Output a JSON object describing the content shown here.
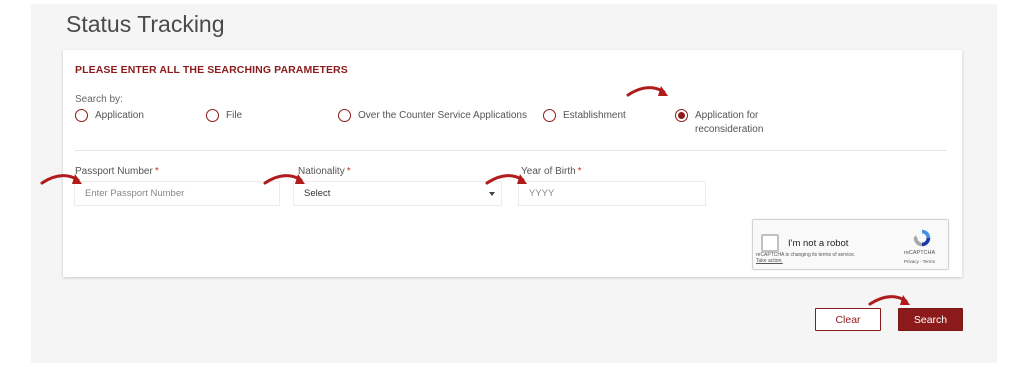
{
  "page": {
    "title": "Status Tracking"
  },
  "form": {
    "section_title": "PLEASE ENTER ALL THE SEARCHING PARAMETERS",
    "search_by_label": "Search by:",
    "search_by_options": [
      {
        "label": "Application",
        "selected": false
      },
      {
        "label": "File",
        "selected": false
      },
      {
        "label": "Over the Counter Service Applications",
        "selected": false
      },
      {
        "label": "Establishment",
        "selected": false
      },
      {
        "label": "Application for reconsideration",
        "selected": true
      }
    ],
    "fields": {
      "passport": {
        "label": "Passport Number",
        "required_mark": "*",
        "placeholder": "Enter Passport Number",
        "value": ""
      },
      "nationality": {
        "label": "Nationality",
        "required_mark": "*",
        "selected": "Select"
      },
      "year_of_birth": {
        "label": "Year of Birth",
        "required_mark": "*",
        "placeholder": "YYYY",
        "value": ""
      }
    }
  },
  "recaptcha": {
    "checkbox_label": "I'm not a robot",
    "notice": "reCAPTCHA is changing its terms of service.",
    "notice_link": "Take action.",
    "brand": "reCAPTCHA",
    "terms": "Privacy - Terms"
  },
  "actions": {
    "clear_label": "Clear",
    "search_label": "Search"
  },
  "colors": {
    "accent": "#8b1a1a",
    "annotation_arrow": "#b01c1c",
    "background_panel": "#f5f5f5"
  },
  "icons": {
    "arrow": "annotation-arrow-icon",
    "dropdown": "caret-down-icon",
    "recaptcha": "recaptcha-logo-icon"
  }
}
